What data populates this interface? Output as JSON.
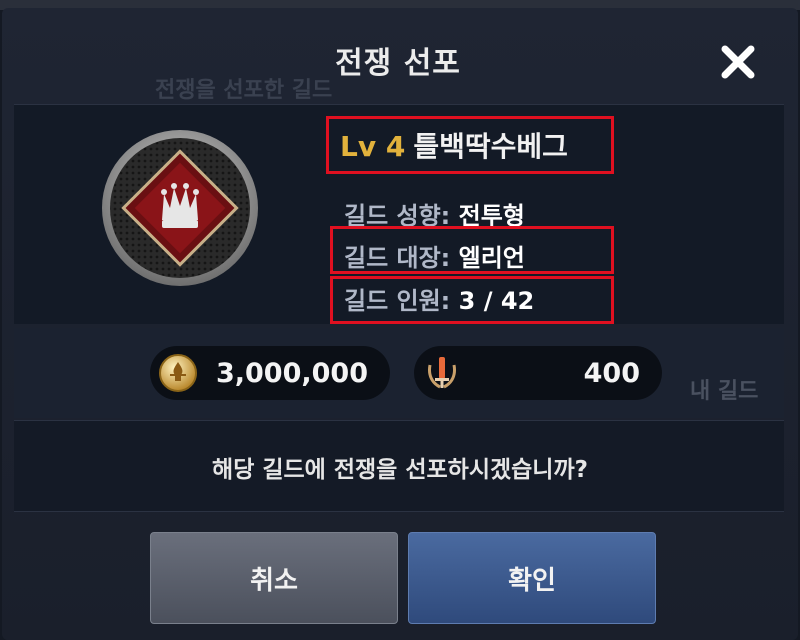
{
  "background": {
    "ghost_text_1": "전쟁을 선포한 길드",
    "ghost_text_2": "내 길드"
  },
  "dialog": {
    "title": "전쟁 선포",
    "close_icon": "close-icon",
    "guild": {
      "level": "Lv 4",
      "name": "틀백딱수베그",
      "emblem_icon": "crown-emblem-icon",
      "stats": [
        {
          "label": "길드 성향:",
          "value": "전투형"
        },
        {
          "label": "길드 대장:",
          "value": "엘리언"
        },
        {
          "label": "길드 인원:",
          "value": "3 / 42"
        }
      ]
    },
    "costs": [
      {
        "icon": "gold-coin-icon",
        "value": "3,000,000"
      },
      {
        "icon": "sword-laurel-icon",
        "value": "400"
      }
    ],
    "question": "해당 길드에 전쟁을 선포하시겠습니까?",
    "buttons": {
      "cancel": "취소",
      "confirm": "확인"
    }
  },
  "colors": {
    "level": "#e2b23c",
    "highlight_box": "#e01020",
    "confirm_button": "#3a5a90",
    "cancel_button": "#5a5f6c"
  }
}
